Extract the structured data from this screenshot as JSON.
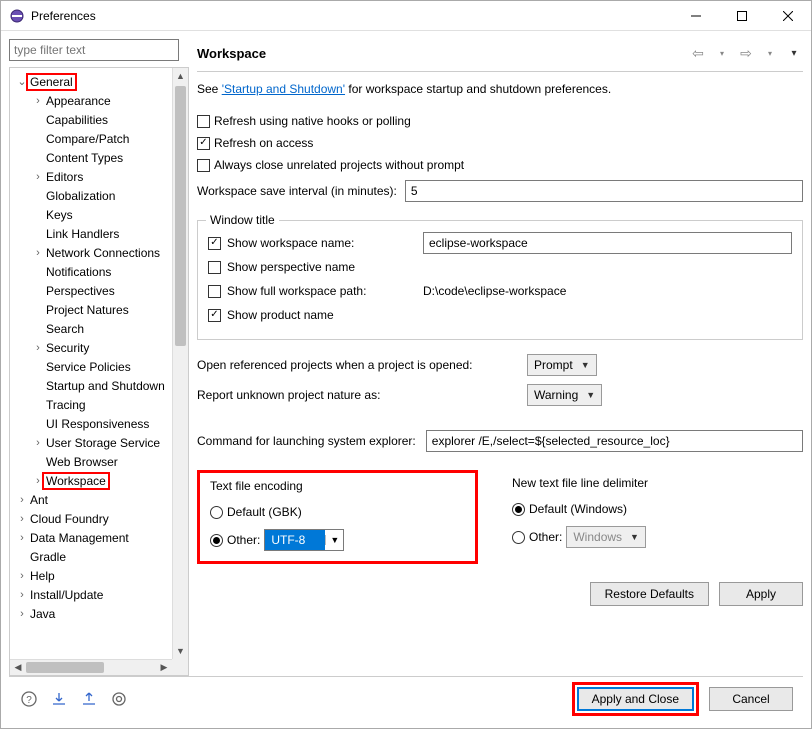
{
  "titlebar": {
    "title": "Preferences"
  },
  "filter": {
    "placeholder": "type filter text"
  },
  "tree": {
    "general": "General",
    "appearance": "Appearance",
    "capabilities": "Capabilities",
    "compare_patch": "Compare/Patch",
    "content_types": "Content Types",
    "editors": "Editors",
    "globalization": "Globalization",
    "keys": "Keys",
    "link_handlers": "Link Handlers",
    "network": "Network Connections",
    "notifications": "Notifications",
    "perspectives": "Perspectives",
    "project_natures": "Project Natures",
    "search": "Search",
    "security": "Security",
    "service_policies": "Service Policies",
    "startup_shutdown": "Startup and Shutdown",
    "tracing": "Tracing",
    "ui_responsiveness": "UI Responsiveness",
    "user_storage": "User Storage Service",
    "web_browser": "Web Browser",
    "workspace": "Workspace",
    "ant": "Ant",
    "cloud_foundry": "Cloud Foundry",
    "data_management": "Data Management",
    "gradle": "Gradle",
    "help": "Help",
    "install_update": "Install/Update",
    "java": "Java"
  },
  "page": {
    "title": "Workspace",
    "see_prefix": "See ",
    "see_link": "'Startup and Shutdown'",
    "see_suffix": " for workspace startup and shutdown preferences.",
    "refresh_native": "Refresh using native hooks or polling",
    "refresh_access": "Refresh on access",
    "always_close": "Always close unrelated projects without prompt",
    "save_interval_label": "Workspace save interval (in minutes):",
    "save_interval_value": "5",
    "window_title": {
      "group_title": "Window title",
      "show_workspace_name": "Show workspace name:",
      "workspace_name_value": "eclipse-workspace",
      "show_perspective": "Show perspective name",
      "show_full_path": "Show full workspace path:",
      "full_path_value": "D:\\code\\eclipse-workspace",
      "show_product": "Show product name"
    },
    "open_ref_label": "Open referenced projects when a project is opened:",
    "open_ref_value": "Prompt",
    "report_nature_label": "Report unknown project nature as:",
    "report_nature_value": "Warning",
    "launch_cmd_label": "Command for launching system explorer:",
    "launch_cmd_value": "explorer /E,/select=${selected_resource_loc}",
    "encoding": {
      "group_title": "Text file encoding",
      "default_label": "Default (GBK)",
      "other_label": "Other:",
      "other_value": "UTF-8"
    },
    "delimiter": {
      "group_title": "New text file line delimiter",
      "default_label": "Default (Windows)",
      "other_label": "Other:",
      "other_value": "Windows"
    },
    "restore_defaults": "Restore Defaults",
    "apply": "Apply"
  },
  "footer": {
    "apply_close": "Apply and Close",
    "cancel": "Cancel"
  }
}
